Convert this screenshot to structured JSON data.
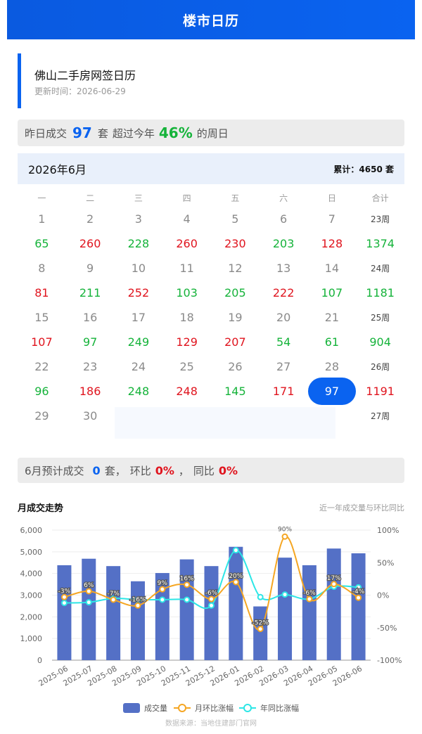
{
  "header": {
    "title": "楼市日历"
  },
  "page": {
    "title": "佛山二手房网签日历",
    "updated": "更新时间：2026-06-29"
  },
  "yesterday": {
    "prefix": "昨日成交",
    "count": "97",
    "unit": "套",
    "mid": "超过今年",
    "pct": "46%",
    "suffix": "的周日"
  },
  "month": {
    "label": "2026年6月",
    "summary": "累计：4650 套"
  },
  "weekdays": [
    "一",
    "二",
    "三",
    "四",
    "五",
    "六",
    "日",
    "合计"
  ],
  "weeks": [
    {
      "days": [
        "1",
        "2",
        "3",
        "4",
        "5",
        "6",
        "7"
      ],
      "week_label": "23周",
      "values": [
        "65",
        "260",
        "228",
        "260",
        "230",
        "203",
        "128"
      ],
      "colors": [
        "green",
        "red",
        "green",
        "red",
        "red",
        "green",
        "red"
      ],
      "total": "1374",
      "total_color": "green"
    },
    {
      "days": [
        "8",
        "9",
        "10",
        "11",
        "12",
        "13",
        "14"
      ],
      "week_label": "24周",
      "values": [
        "81",
        "211",
        "252",
        "103",
        "205",
        "222",
        "107"
      ],
      "colors": [
        "red",
        "green",
        "red",
        "green",
        "green",
        "red",
        "green"
      ],
      "total": "1181",
      "total_color": "green"
    },
    {
      "days": [
        "15",
        "16",
        "17",
        "18",
        "19",
        "20",
        "21"
      ],
      "week_label": "25周",
      "values": [
        "107",
        "97",
        "249",
        "129",
        "207",
        "54",
        "61"
      ],
      "colors": [
        "red",
        "green",
        "green",
        "red",
        "red",
        "green",
        "green"
      ],
      "total": "904",
      "total_color": "green"
    },
    {
      "days": [
        "22",
        "23",
        "24",
        "25",
        "26",
        "27",
        "28"
      ],
      "week_label": "26周",
      "values": [
        "96",
        "186",
        "248",
        "248",
        "145",
        "171",
        "97"
      ],
      "colors": [
        "green",
        "red",
        "green",
        "red",
        "green",
        "red",
        "selected"
      ],
      "total": "1191",
      "total_color": "red"
    },
    {
      "days": [
        "29",
        "30",
        "",
        "",
        "",
        "",
        ""
      ],
      "week_label": "27周",
      "values": [],
      "colors": [],
      "total": "",
      "total_color": ""
    }
  ],
  "forecast": {
    "prefix": "6月预计成交",
    "count": "0",
    "unit": "套，",
    "mom_label": "环比",
    "mom": "0%",
    "sep": "，",
    "yoy_label": "同比",
    "yoy": "0%"
  },
  "trend": {
    "title": "月成交走势",
    "subtitle": "近一年成交量与环比同比"
  },
  "chart_data": {
    "type": "bar",
    "categories": [
      "2025-06",
      "2025-07",
      "2025-08",
      "2025-09",
      "2025-10",
      "2025-11",
      "2025-12",
      "2026-01",
      "2026-02",
      "2026-03",
      "2026-04",
      "2026-05",
      "2026-06"
    ],
    "series": [
      {
        "name": "成交量",
        "type": "bar",
        "axis": "left",
        "color": "#5470c6",
        "values": [
          4380,
          4680,
          4340,
          3640,
          4020,
          4650,
          4340,
          5230,
          2480,
          4730,
          4380,
          5150,
          4930
        ]
      },
      {
        "name": "月环比涨幅",
        "type": "line",
        "axis": "right",
        "color": "#f5a623",
        "values": [
          -3,
          6,
          -7,
          -16,
          9,
          16,
          -6,
          20,
          -52,
          90,
          -6,
          17,
          -4
        ]
      },
      {
        "name": "年同比涨幅",
        "type": "line",
        "axis": "right",
        "color": "#2de6e6",
        "values": [
          -12,
          -11,
          -5,
          -7,
          -7,
          -7,
          -16,
          69,
          -3,
          1,
          -6,
          13,
          12
        ]
      }
    ],
    "bar_labels": [
      "-3%",
      "6%",
      "-7%",
      "-16%",
      "9%",
      "16%",
      "-6%",
      "20%",
      "-52%",
      "90%",
      "-6%",
      "17%",
      "-4%"
    ],
    "ylim_left": [
      0,
      6000
    ],
    "yticks_left": [
      "0",
      "1,000",
      "2,000",
      "3,000",
      "4,000",
      "5,000",
      "6,000"
    ],
    "ylim_right": [
      -100,
      100
    ],
    "yticks_right": [
      "-100%",
      "-50%",
      "0%",
      "50%",
      "100%"
    ],
    "legend": [
      "成交量",
      "月环比涨幅",
      "年同比涨幅"
    ],
    "legend_position": "bottom",
    "grid": true
  },
  "source": "数据来源：当地住建部门官网",
  "colors": {
    "accent": "#0a63f0",
    "up": "#e0141e",
    "down": "#15b33a"
  }
}
